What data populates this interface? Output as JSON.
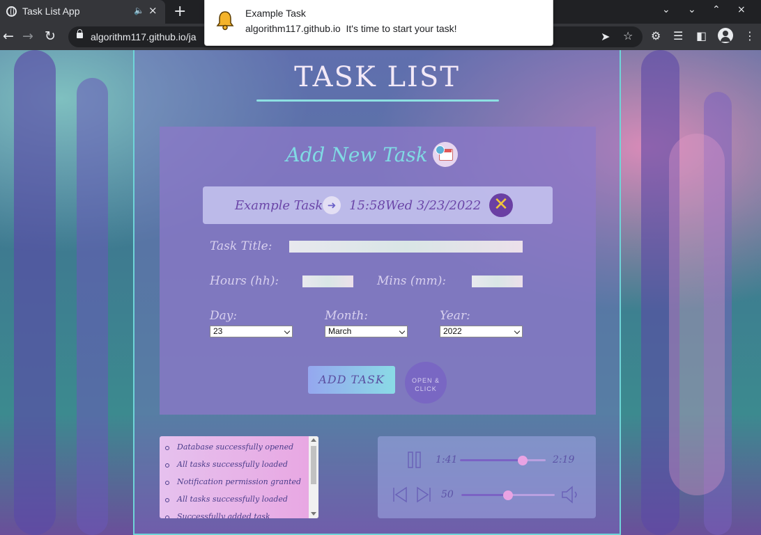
{
  "browser": {
    "tab_title": "Task List App",
    "audio_icon": "speaker-icon",
    "tab_close": "×",
    "new_tab": "+",
    "url": "algorithm117.github.io/ja",
    "window_controls": [
      "⌄",
      "⌄",
      "⌃",
      "×"
    ]
  },
  "notification": {
    "title": "Example Task",
    "body": "algorithm117.github.io  It's time to start your task!"
  },
  "app": {
    "title": "TASK LIST",
    "form": {
      "heading": "Add New Task",
      "pending_task": {
        "title": "Example Task",
        "time": "15:58",
        "date": "Wed 3/23/2022",
        "delete_symbol": "✕"
      },
      "task_title_label": "Task Title:",
      "task_title_value": "",
      "hours_label": "Hours (hh):",
      "hours_value": "",
      "mins_label": "Mins (mm):",
      "mins_value": "",
      "day_label": "Day:",
      "day_value": "23",
      "month_label": "Month:",
      "month_value": "March",
      "year_label": "Year:",
      "year_value": "2022",
      "add_button": "ADD TASK",
      "open_button_line1": "OPEN &",
      "open_button_line2": "CLICK"
    },
    "log": [
      "Database successfully opened",
      "All tasks successfully loaded",
      "Notification permission granted",
      "All tasks successfully loaded",
      "Successfully added task"
    ],
    "player": {
      "elapsed": "1:41",
      "duration": "2:19",
      "progress": 0.73,
      "volume": 50,
      "volume_fraction": 0.5
    }
  },
  "colors": {
    "accent": "#80dbe4",
    "frame": "#6fd5d8",
    "task_text": "#6b46a8"
  }
}
